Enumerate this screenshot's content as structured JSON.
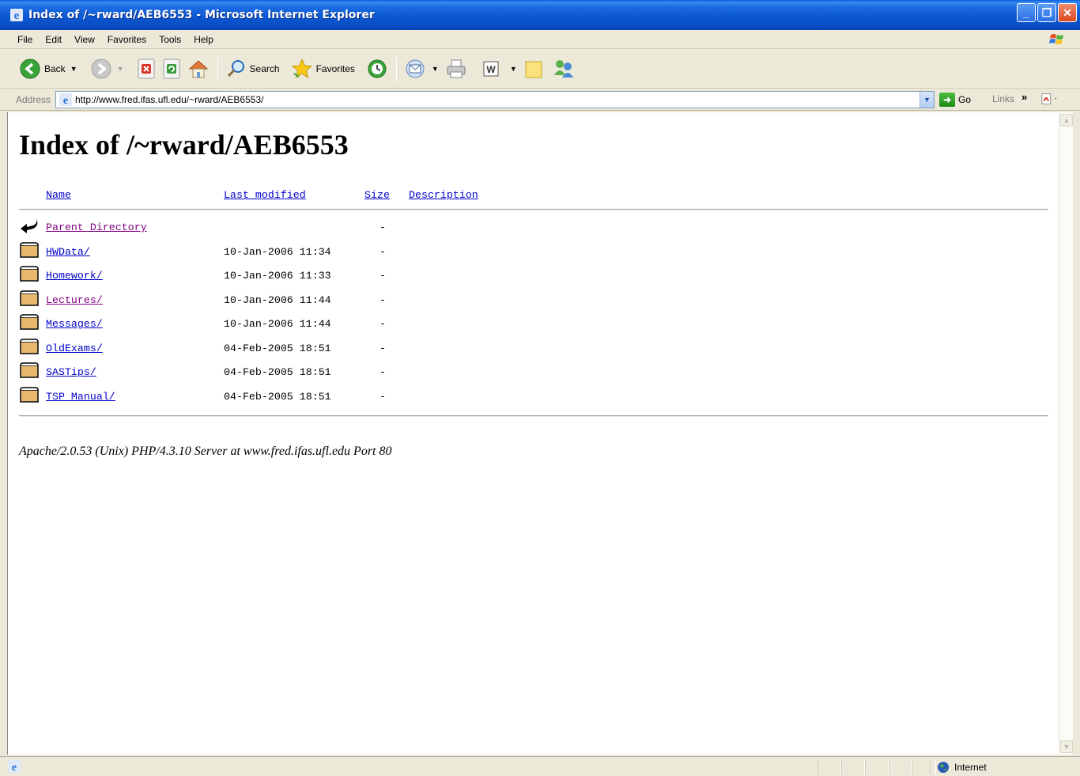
{
  "window": {
    "title": "Index of /~rward/AEB6553 - Microsoft Internet Explorer",
    "minimize_glyph": "_",
    "restore_glyph": "❐",
    "close_glyph": "✕"
  },
  "menu": [
    "File",
    "Edit",
    "View",
    "Favorites",
    "Tools",
    "Help"
  ],
  "toolbar": {
    "back_label": "Back",
    "search_label": "Search",
    "favorites_label": "Favorites"
  },
  "address": {
    "label": "Address",
    "url": "http://www.fred.ifas.ufl.edu/~rward/AEB6553/",
    "go_label": "Go",
    "links_label": "Links",
    "links_chevron": "»"
  },
  "page": {
    "heading": "Index of /~rward/AEB6553",
    "columns": {
      "name": "Name",
      "last_modified": "Last modified",
      "size": "Size",
      "description": "Description"
    },
    "rows": [
      {
        "name": "Parent Directory",
        "date": "",
        "size": "-",
        "icon": "back-arrow-icon",
        "visited": true
      },
      {
        "name": "HWData/",
        "date": "10-Jan-2006 11:34",
        "size": "-",
        "icon": "folder-icon",
        "visited": false
      },
      {
        "name": "Homework/",
        "date": "10-Jan-2006 11:33",
        "size": "-",
        "icon": "folder-icon",
        "visited": false
      },
      {
        "name": "Lectures/",
        "date": "10-Jan-2006 11:44",
        "size": "-",
        "icon": "folder-icon",
        "visited": true
      },
      {
        "name": "Messages/",
        "date": "10-Jan-2006 11:44",
        "size": "-",
        "icon": "folder-icon",
        "visited": false
      },
      {
        "name": "OldExams/",
        "date": "04-Feb-2005 18:51",
        "size": "-",
        "icon": "folder-icon",
        "visited": false
      },
      {
        "name": "SASTips/",
        "date": "04-Feb-2005 18:51",
        "size": "-",
        "icon": "folder-icon",
        "visited": false
      },
      {
        "name": "TSP_Manual/",
        "date": "04-Feb-2005 18:51",
        "size": "-",
        "icon": "folder-icon",
        "visited": false
      }
    ],
    "server_signature": "Apache/2.0.53 (Unix) PHP/4.3.10 Server at www.fred.ifas.ufl.edu Port 80"
  },
  "status": {
    "zone_label": "Internet"
  },
  "colors": {
    "link": "#0000cc",
    "visited": "#800080",
    "titlebar": "#0a56d0"
  }
}
